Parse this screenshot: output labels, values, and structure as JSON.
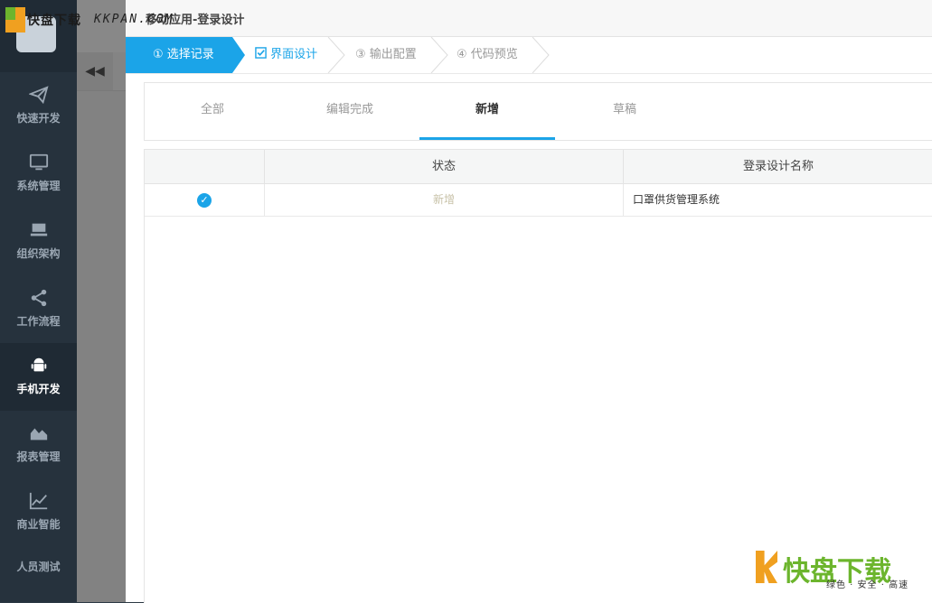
{
  "watermark_top": {
    "brand": "快盘下载",
    "url": "KKPAN.COM"
  },
  "sidebar": {
    "items": [
      {
        "label": "快速开发",
        "icon": "paper-plane-icon"
      },
      {
        "label": "系统管理",
        "icon": "monitor-icon"
      },
      {
        "label": "组织架构",
        "icon": "org-icon"
      },
      {
        "label": "工作流程",
        "icon": "share-icon"
      },
      {
        "label": "手机开发",
        "icon": "android-icon"
      },
      {
        "label": "报表管理",
        "icon": "area-chart-icon"
      },
      {
        "label": "商业智能",
        "icon": "line-chart-icon"
      },
      {
        "label": "人员测试",
        "icon": ""
      }
    ]
  },
  "dialog": {
    "title": "移动应用-登录设计",
    "steps": [
      {
        "label": "① 选择记录"
      },
      {
        "label": "界面设计"
      },
      {
        "label": "③ 输出配置"
      },
      {
        "label": "④ 代码预览"
      }
    ],
    "tabs": [
      {
        "label": "全部"
      },
      {
        "label": "编辑完成"
      },
      {
        "label": "新增"
      },
      {
        "label": "草稿"
      }
    ],
    "grid": {
      "headers": [
        "状态",
        "登录设计名称"
      ],
      "rows": [
        {
          "status": "新增",
          "name": "口罩供货管理系统"
        }
      ]
    }
  },
  "watermark_bottom": {
    "big": "快盘下载",
    "sub": "绿色 · 安全 · 高速"
  },
  "colors": {
    "accent": "#1ba4e8",
    "sidebar": "#26323d"
  }
}
